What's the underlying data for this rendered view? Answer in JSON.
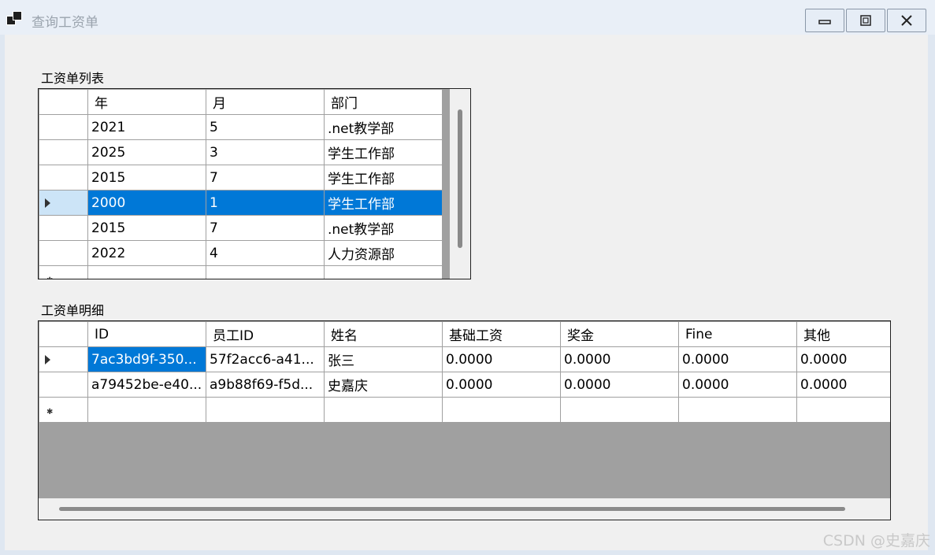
{
  "window": {
    "title": "查询工资单"
  },
  "list_section": {
    "label": "工资单列表",
    "columns": [
      "年",
      "月",
      "部门"
    ],
    "rows": [
      [
        "2021",
        "5",
        ".net教学部"
      ],
      [
        "2025",
        "3",
        "学生工作部"
      ],
      [
        "2015",
        "7",
        "学生工作部"
      ],
      [
        "2000",
        "1",
        "学生工作部"
      ],
      [
        "2015",
        "7",
        ".net教学部"
      ],
      [
        "2022",
        "4",
        "人力资源部"
      ]
    ],
    "selected_row": 3
  },
  "detail_section": {
    "label": "工资单明细",
    "columns": [
      "ID",
      "员工ID",
      "姓名",
      "基础工资",
      "奖金",
      "Fine",
      "其他"
    ],
    "rows": [
      [
        "7ac3bd9f-350...",
        "57f2acc6-a41...",
        "张三",
        "0.0000",
        "0.0000",
        "0.0000",
        "0.0000"
      ],
      [
        "a79452be-e40...",
        "a9b88f69-f5d...",
        "史嘉庆",
        "0.0000",
        "0.0000",
        "0.0000",
        "0.0000"
      ]
    ]
  },
  "watermark": "CSDN @史嘉庆",
  "colors": {
    "selection": "#0078d7",
    "empty_area": "#a0a0a0"
  }
}
